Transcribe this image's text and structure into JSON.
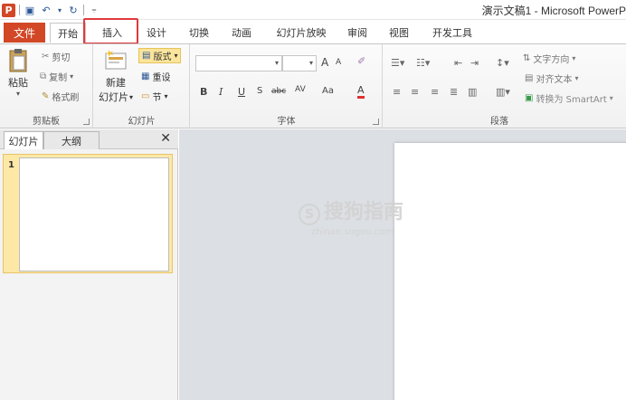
{
  "titlebar": {
    "app_icon": "P",
    "doc_title": "演示文稿1 - Microsoft PowerP",
    "qat": [
      {
        "icon": "save-icon",
        "glyph": "▣"
      },
      {
        "icon": "undo-icon",
        "glyph": "↶"
      },
      {
        "icon": "undo-dropdown-icon",
        "glyph": "▾"
      },
      {
        "icon": "redo-icon",
        "glyph": "↻"
      },
      {
        "icon": "customize-qat-icon",
        "glyph": "⩦"
      }
    ]
  },
  "tabs": {
    "file": "文件",
    "items": [
      "开始",
      "插入",
      "设计",
      "切换",
      "动画",
      "幻灯片放映",
      "审阅",
      "视图",
      "开发工具"
    ]
  },
  "ribbon": {
    "clipboard": {
      "label": "剪贴板",
      "paste": "粘贴",
      "cut": "剪切",
      "copy": "复制",
      "format_painter": "格式刷"
    },
    "slides": {
      "label": "幻灯片",
      "new_slide_line1": "新建",
      "new_slide_line2": "幻灯片",
      "layout": "版式",
      "reset": "重设",
      "section": "节"
    },
    "font": {
      "label": "字体",
      "grow": "A",
      "shrink": "A",
      "clear": "A",
      "bold": "B",
      "italic": "I",
      "underline": "U",
      "shadow": "S",
      "strike": "abc",
      "spacing": "AV",
      "case": "Aa",
      "color": "A"
    },
    "paragraph": {
      "label": "段落",
      "text_direction": "文字方向",
      "align_text": "对齐文本",
      "convert_smartart": "转换为 SmartArt"
    }
  },
  "pane": {
    "tab_slides": "幻灯片",
    "tab_outline": "大纲",
    "close": "✕",
    "slide_number": "1"
  },
  "watermark": {
    "main": "搜狗指南",
    "logo": "S",
    "sub": "zhinan.sogou.com"
  },
  "colors": {
    "file_tab": "#d24726",
    "highlight": "#e0393e",
    "slide_selected": "#fde8a6"
  }
}
